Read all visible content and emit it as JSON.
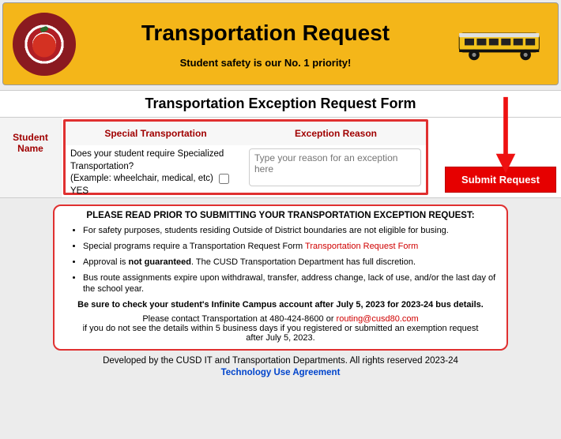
{
  "banner": {
    "title": "Transportation Request",
    "subtitle": "Student safety is our No. 1 priority!"
  },
  "form": {
    "title": "Transportation Exception Request Form",
    "student_label_line1": "Student",
    "student_label_line2": "Name",
    "col_special": "Special Transportation",
    "col_reason": "Exception Reason",
    "sp_q": "Does your student require Specialized Transportation?",
    "sp_example": "(Example: wheelchair, medical, etc)",
    "sp_yes": "YES",
    "reason_placeholder": "Type your reason for an exception here",
    "submit_label": "Submit Request"
  },
  "notice": {
    "heading": "PLEASE READ PRIOR TO SUBMITTING YOUR TRANSPORTATION EXCEPTION REQUEST:",
    "bullets": [
      {
        "text": "For safety purposes, students residing Outside of District boundaries are not eligible for busing."
      },
      {
        "text": "Special programs require a Transportation Request Form",
        "link": "Transportation Request Form"
      },
      {
        "pre": "Approval is ",
        "strong": "not guaranteed",
        "post": ". The CUSD Transportation Department has full discretion."
      },
      {
        "text": "Bus route assignments expire upon withdrawal, transfer, address change, lack of use, and/or the last day of the school year."
      }
    ],
    "check_msg": "Be sure to check your student's Infinite Campus account after July 5, 2023 for 2023-24 bus details.",
    "contact_pre": "Please contact Transportation at 480-424-8600 or ",
    "contact_email": "routing@cusd80.com",
    "contact_post1": "if you do not see the details within 5 business days if you registered or submitted an exemption request",
    "contact_post2": "after July 5, 2023."
  },
  "footer": {
    "line1": "Developed by the CUSD IT and Transportation Departments. All rights reserved 2023-24",
    "link": "Technology Use Agreement"
  }
}
